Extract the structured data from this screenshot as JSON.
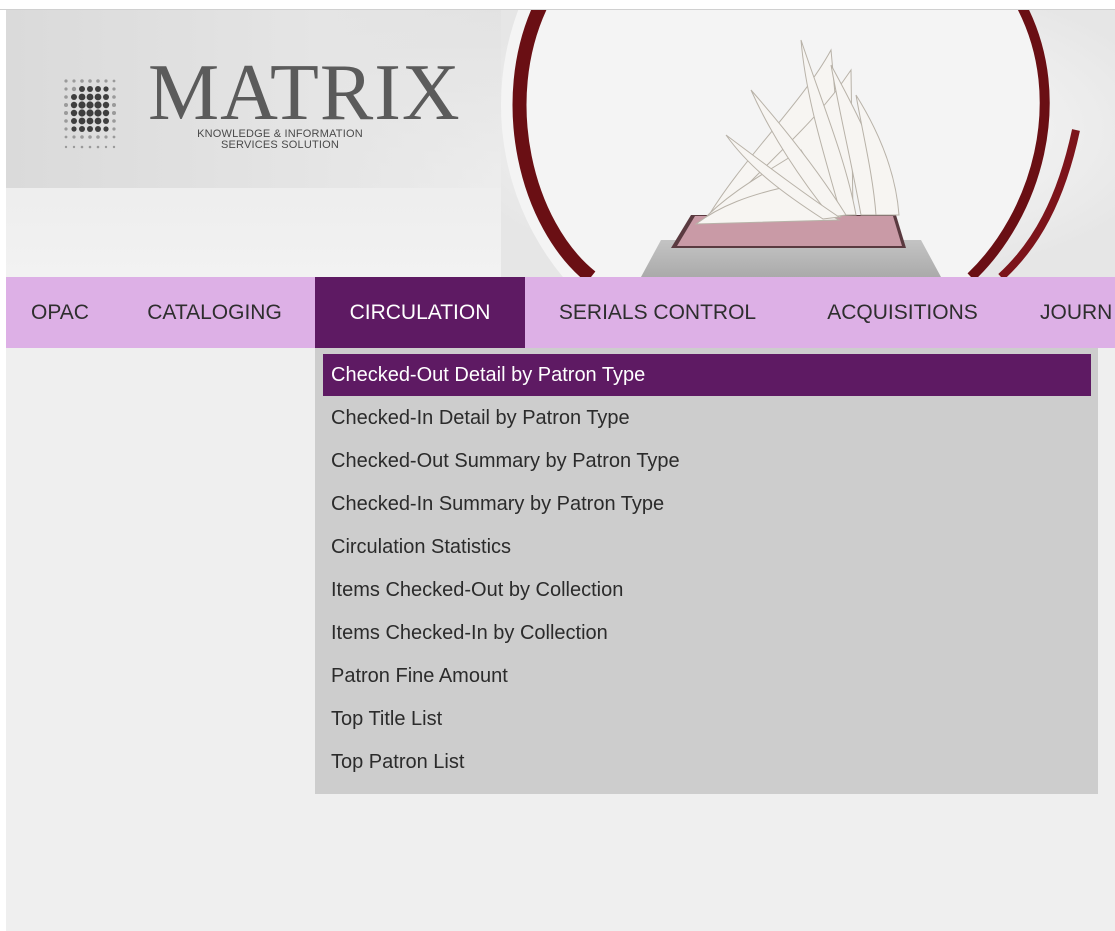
{
  "branding": {
    "logo_word": "MATRIX",
    "logo_tag_line1": "KNOWLEDGE & INFORMATION",
    "logo_tag_line2": "SERVICES SOLUTION"
  },
  "nav": {
    "items": [
      {
        "label": "OPAC"
      },
      {
        "label": "CATALOGING"
      },
      {
        "label": "CIRCULATION"
      },
      {
        "label": "SERIALS CONTROL"
      },
      {
        "label": "ACQUISITIONS"
      },
      {
        "label": "JOURN"
      }
    ],
    "active": "CIRCULATION"
  },
  "dropdown": {
    "items": [
      {
        "label": "Checked-Out Detail by Patron Type"
      },
      {
        "label": "Checked-In Detail by Patron Type"
      },
      {
        "label": "Checked-Out Summary by Patron Type"
      },
      {
        "label": "Checked-In Summary by Patron Type"
      },
      {
        "label": "Circulation Statistics"
      },
      {
        "label": "Items Checked-Out by Collection"
      },
      {
        "label": "Items Checked-In by Collection"
      },
      {
        "label": "Patron Fine Amount"
      },
      {
        "label": "Top Title List"
      },
      {
        "label": "Top Patron List"
      }
    ],
    "highlighted": "Checked-Out Detail by Patron Type"
  },
  "colors": {
    "nav_bg": "#ddb0e6",
    "accent": "#5e1a63",
    "dropdown_bg": "#cdcdcd",
    "art_ring": "#6a0f14"
  }
}
